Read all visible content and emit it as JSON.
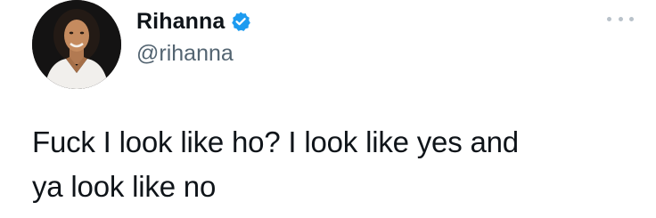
{
  "tweet": {
    "author": {
      "display_name": "Rihanna",
      "handle": "@rihanna",
      "verified": true,
      "avatar_icon": "profile-photo"
    },
    "more_icon": "more-horizontal-icon",
    "text": "Fuck I look like ho? I look like yes and\nya look like no"
  },
  "colors": {
    "text_primary": "#0f1419",
    "text_secondary": "#536471",
    "verified_blue": "#1d9bf0",
    "more_dots": "#b9c2ca"
  }
}
